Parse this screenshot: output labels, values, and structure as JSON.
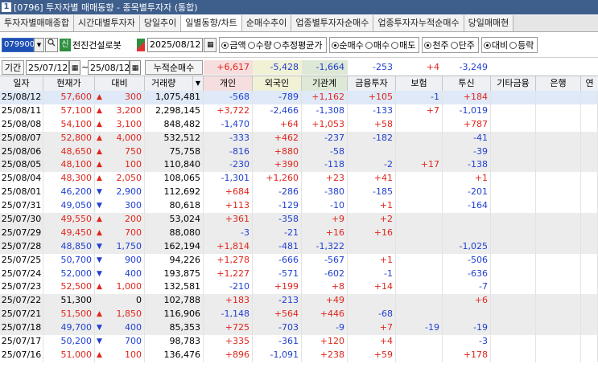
{
  "window": {
    "number": "1",
    "title": "[0796] 투자자별 매매동향 - 종목별투자자 (통합)"
  },
  "tabs": [
    "투자자별매매종합",
    "시간대별투자자",
    "당일추이",
    "일별동향/차트",
    "순매수추이",
    "업종별투자자순매수",
    "업종투자자누적순매수",
    "당일매매현"
  ],
  "toolbar": {
    "code": "079900",
    "credit_badge": "신",
    "stock_name": "전진건설로봇",
    "date": "2025/08/12",
    "radio_group1": [
      {
        "label": "금액",
        "selected": true
      },
      {
        "label": "수량",
        "selected": false
      },
      {
        "label": "추정평균가",
        "selected": false
      }
    ],
    "radio_group2": [
      {
        "label": "순매수",
        "selected": true
      },
      {
        "label": "매수",
        "selected": false
      },
      {
        "label": "매도",
        "selected": false
      }
    ],
    "radio_group3": [
      {
        "label": "천주",
        "selected": true
      },
      {
        "label": "단주",
        "selected": false
      }
    ],
    "radio_group4": [
      {
        "label": "대비",
        "selected": true
      },
      {
        "label": "등락",
        "selected": false
      }
    ]
  },
  "period": {
    "label": "기간",
    "start": "25/07/12",
    "tilde": "~",
    "end": "25/08/12",
    "cumulative_label": "누적순매수",
    "totals": {
      "individual": "+6,617",
      "foreign": "-5,428",
      "institution": "-1,664",
      "finance": "-253",
      "insurance": "+4",
      "trust": "-3,249",
      "other_finance": "",
      "bank": ""
    }
  },
  "columns": [
    "일자",
    "현재가",
    "대비",
    "거래량",
    "개인",
    "외국인",
    "기관계",
    "금융투자",
    "보험",
    "투신",
    "기타금융",
    "은행",
    "연"
  ],
  "rows": [
    {
      "date": "25/08/12",
      "price": "57,600",
      "dir": "up",
      "change": "300",
      "volume": "1,075,481",
      "individual": "-568",
      "foreign": "-789",
      "institution": "+1,162",
      "finance": "+105",
      "insurance": "-1",
      "trust": "+184",
      "other_finance": "",
      "bank": ""
    },
    {
      "date": "25/08/11",
      "price": "57,100",
      "dir": "up",
      "change": "3,200",
      "volume": "2,298,145",
      "individual": "+3,722",
      "foreign": "-2,466",
      "institution": "-1,308",
      "finance": "-133",
      "insurance": "+7",
      "trust": "-1,019",
      "other_finance": "",
      "bank": ""
    },
    {
      "date": "25/08/08",
      "price": "54,100",
      "dir": "up",
      "change": "3,100",
      "volume": "848,482",
      "individual": "-1,470",
      "foreign": "+64",
      "institution": "+1,053",
      "finance": "+58",
      "insurance": "",
      "trust": "+787",
      "other_finance": "",
      "bank": ""
    },
    {
      "date": "25/08/07",
      "price": "52,800",
      "dir": "up",
      "change": "4,000",
      "volume": "532,512",
      "individual": "-333",
      "foreign": "+462",
      "institution": "-237",
      "finance": "-182",
      "insurance": "",
      "trust": "-41",
      "other_finance": "",
      "bank": ""
    },
    {
      "date": "25/08/06",
      "price": "48,650",
      "dir": "up",
      "change": "750",
      "volume": "75,758",
      "individual": "-816",
      "foreign": "+880",
      "institution": "-58",
      "finance": "",
      "insurance": "",
      "trust": "-39",
      "other_finance": "",
      "bank": ""
    },
    {
      "date": "25/08/05",
      "price": "48,100",
      "dir": "up",
      "change": "100",
      "volume": "110,840",
      "individual": "-230",
      "foreign": "+390",
      "institution": "-118",
      "finance": "-2",
      "insurance": "+17",
      "trust": "-138",
      "other_finance": "",
      "bank": ""
    },
    {
      "date": "25/08/04",
      "price": "48,300",
      "dir": "up",
      "change": "2,050",
      "volume": "108,065",
      "individual": "-1,301",
      "foreign": "+1,260",
      "institution": "+23",
      "finance": "+41",
      "insurance": "",
      "trust": "+1",
      "other_finance": "",
      "bank": ""
    },
    {
      "date": "25/08/01",
      "price": "46,200",
      "dir": "dn",
      "change": "2,900",
      "volume": "112,692",
      "individual": "+684",
      "foreign": "-286",
      "institution": "-380",
      "finance": "-185",
      "insurance": "",
      "trust": "-201",
      "other_finance": "",
      "bank": ""
    },
    {
      "date": "25/07/31",
      "price": "49,050",
      "dir": "dn",
      "change": "300",
      "volume": "80,618",
      "individual": "+113",
      "foreign": "-129",
      "institution": "-10",
      "finance": "+1",
      "insurance": "",
      "trust": "-164",
      "other_finance": "",
      "bank": ""
    },
    {
      "date": "25/07/30",
      "price": "49,550",
      "dir": "up",
      "change": "200",
      "volume": "53,024",
      "individual": "+361",
      "foreign": "-358",
      "institution": "+9",
      "finance": "+2",
      "insurance": "",
      "trust": "",
      "other_finance": "",
      "bank": ""
    },
    {
      "date": "25/07/29",
      "price": "49,450",
      "dir": "up",
      "change": "700",
      "volume": "88,080",
      "individual": "-3",
      "foreign": "-21",
      "institution": "+16",
      "finance": "+16",
      "insurance": "",
      "trust": "",
      "other_finance": "",
      "bank": ""
    },
    {
      "date": "25/07/28",
      "price": "48,850",
      "dir": "dn",
      "change": "1,750",
      "volume": "162,194",
      "individual": "+1,814",
      "foreign": "-481",
      "institution": "-1,322",
      "finance": "",
      "insurance": "",
      "trust": "-1,025",
      "other_finance": "",
      "bank": ""
    },
    {
      "date": "25/07/25",
      "price": "50,700",
      "dir": "dn",
      "change": "900",
      "volume": "94,226",
      "individual": "+1,278",
      "foreign": "-666",
      "institution": "-567",
      "finance": "+1",
      "insurance": "",
      "trust": "-506",
      "other_finance": "",
      "bank": ""
    },
    {
      "date": "25/07/24",
      "price": "52,000",
      "dir": "dn",
      "change": "400",
      "volume": "193,875",
      "individual": "+1,227",
      "foreign": "-571",
      "institution": "-602",
      "finance": "-1",
      "insurance": "",
      "trust": "-636",
      "other_finance": "",
      "bank": ""
    },
    {
      "date": "25/07/23",
      "price": "52,500",
      "dir": "up",
      "change": "1,000",
      "volume": "132,581",
      "individual": "-210",
      "foreign": "+199",
      "institution": "+8",
      "finance": "+14",
      "insurance": "",
      "trust": "-7",
      "other_finance": "",
      "bank": ""
    },
    {
      "date": "25/07/22",
      "price": "51,300",
      "dir": "none",
      "change": "0",
      "volume": "102,788",
      "individual": "+183",
      "foreign": "-213",
      "institution": "+49",
      "finance": "",
      "insurance": "",
      "trust": "+6",
      "other_finance": "",
      "bank": ""
    },
    {
      "date": "25/07/21",
      "price": "51,500",
      "dir": "up",
      "change": "1,850",
      "volume": "116,906",
      "individual": "-1,148",
      "foreign": "+564",
      "institution": "+446",
      "finance": "-68",
      "insurance": "",
      "trust": "",
      "other_finance": "",
      "bank": ""
    },
    {
      "date": "25/07/18",
      "price": "49,700",
      "dir": "dn",
      "change": "400",
      "volume": "85,353",
      "individual": "+725",
      "foreign": "-703",
      "institution": "-9",
      "finance": "+7",
      "insurance": "-19",
      "trust": "-19",
      "other_finance": "",
      "bank": ""
    },
    {
      "date": "25/07/17",
      "price": "50,200",
      "dir": "dn",
      "change": "700",
      "volume": "98,783",
      "individual": "+335",
      "foreign": "-361",
      "institution": "+120",
      "finance": "+4",
      "insurance": "",
      "trust": "-3",
      "other_finance": "",
      "bank": ""
    },
    {
      "date": "25/07/16",
      "price": "51,000",
      "dir": "up",
      "change": "100",
      "volume": "136,476",
      "individual": "+896",
      "foreign": "-1,091",
      "institution": "+238",
      "finance": "+59",
      "insurance": "",
      "trust": "+178",
      "other_finance": "",
      "bank": ""
    }
  ],
  "colors": {
    "up": "#e0251b",
    "down": "#1f3fd0",
    "selected_row": "#dfe9f7",
    "shaded_row": "#ececec",
    "title_bar": "#3e5e8c"
  },
  "icons": {
    "search": "search-icon",
    "calendar": "calendar-icon",
    "dropdown": "chevron-down-icon",
    "sort": "sort-down-icon"
  }
}
